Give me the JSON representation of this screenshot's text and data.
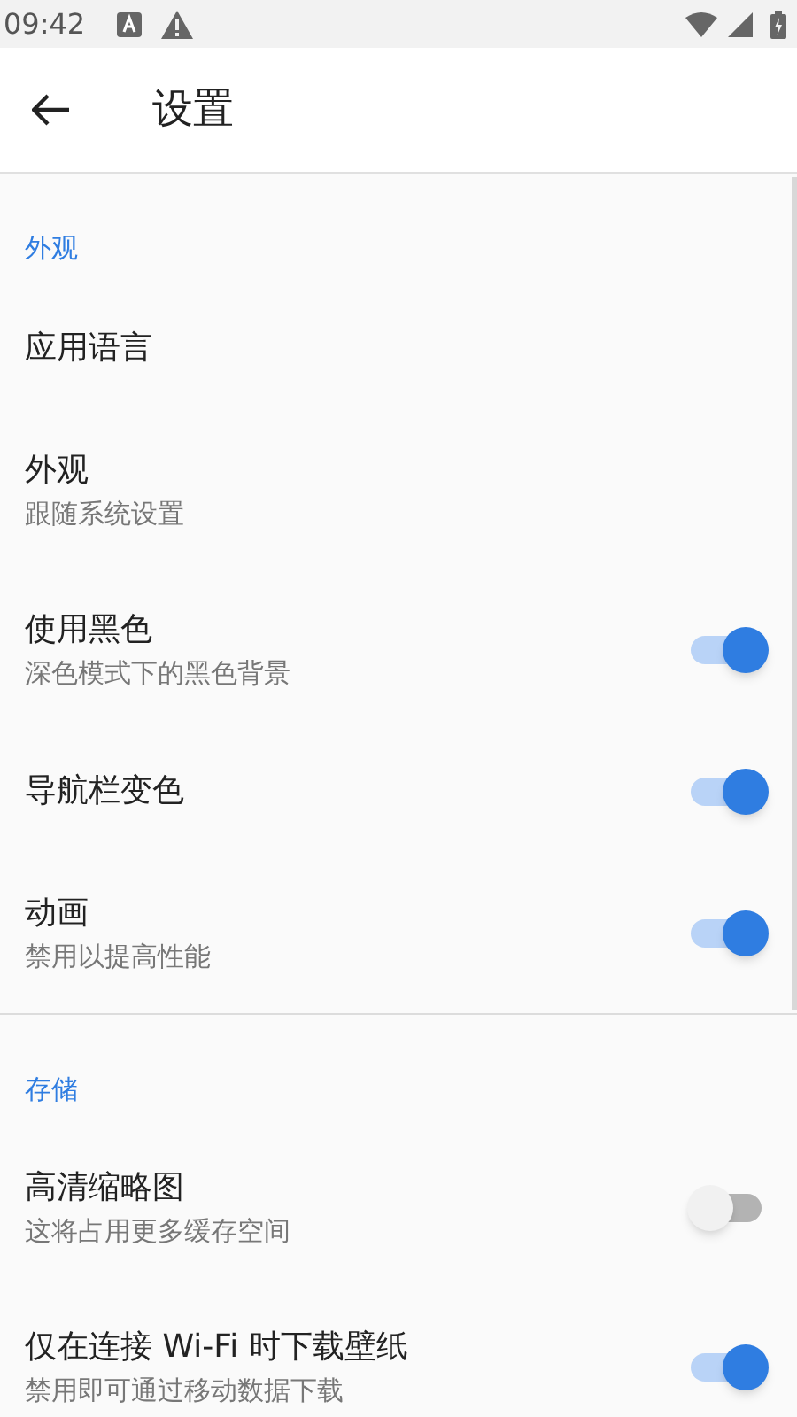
{
  "status_bar": {
    "time": "09:42"
  },
  "app_bar": {
    "title": "设置"
  },
  "sections": [
    {
      "header": "外观",
      "items": [
        {
          "kind": "plain",
          "title": "应用语言"
        },
        {
          "kind": "plain",
          "title": "外观",
          "subtitle": "跟随系统设置"
        },
        {
          "kind": "toggle",
          "title": "使用黑色",
          "subtitle": "深色模式下的黑色背景",
          "on": true
        },
        {
          "kind": "toggle",
          "title": "导航栏变色",
          "on": true
        },
        {
          "kind": "toggle",
          "title": "动画",
          "subtitle": "禁用以提高性能",
          "on": true
        }
      ]
    },
    {
      "header": "存储",
      "items": [
        {
          "kind": "toggle",
          "title": "高清缩略图",
          "subtitle": "这将占用更多缓存空间",
          "on": false
        },
        {
          "kind": "toggle",
          "title": "仅在连接 Wi-Fi 时下载壁纸",
          "subtitle": "禁用即可通过移动数据下载",
          "on": true
        }
      ]
    }
  ]
}
